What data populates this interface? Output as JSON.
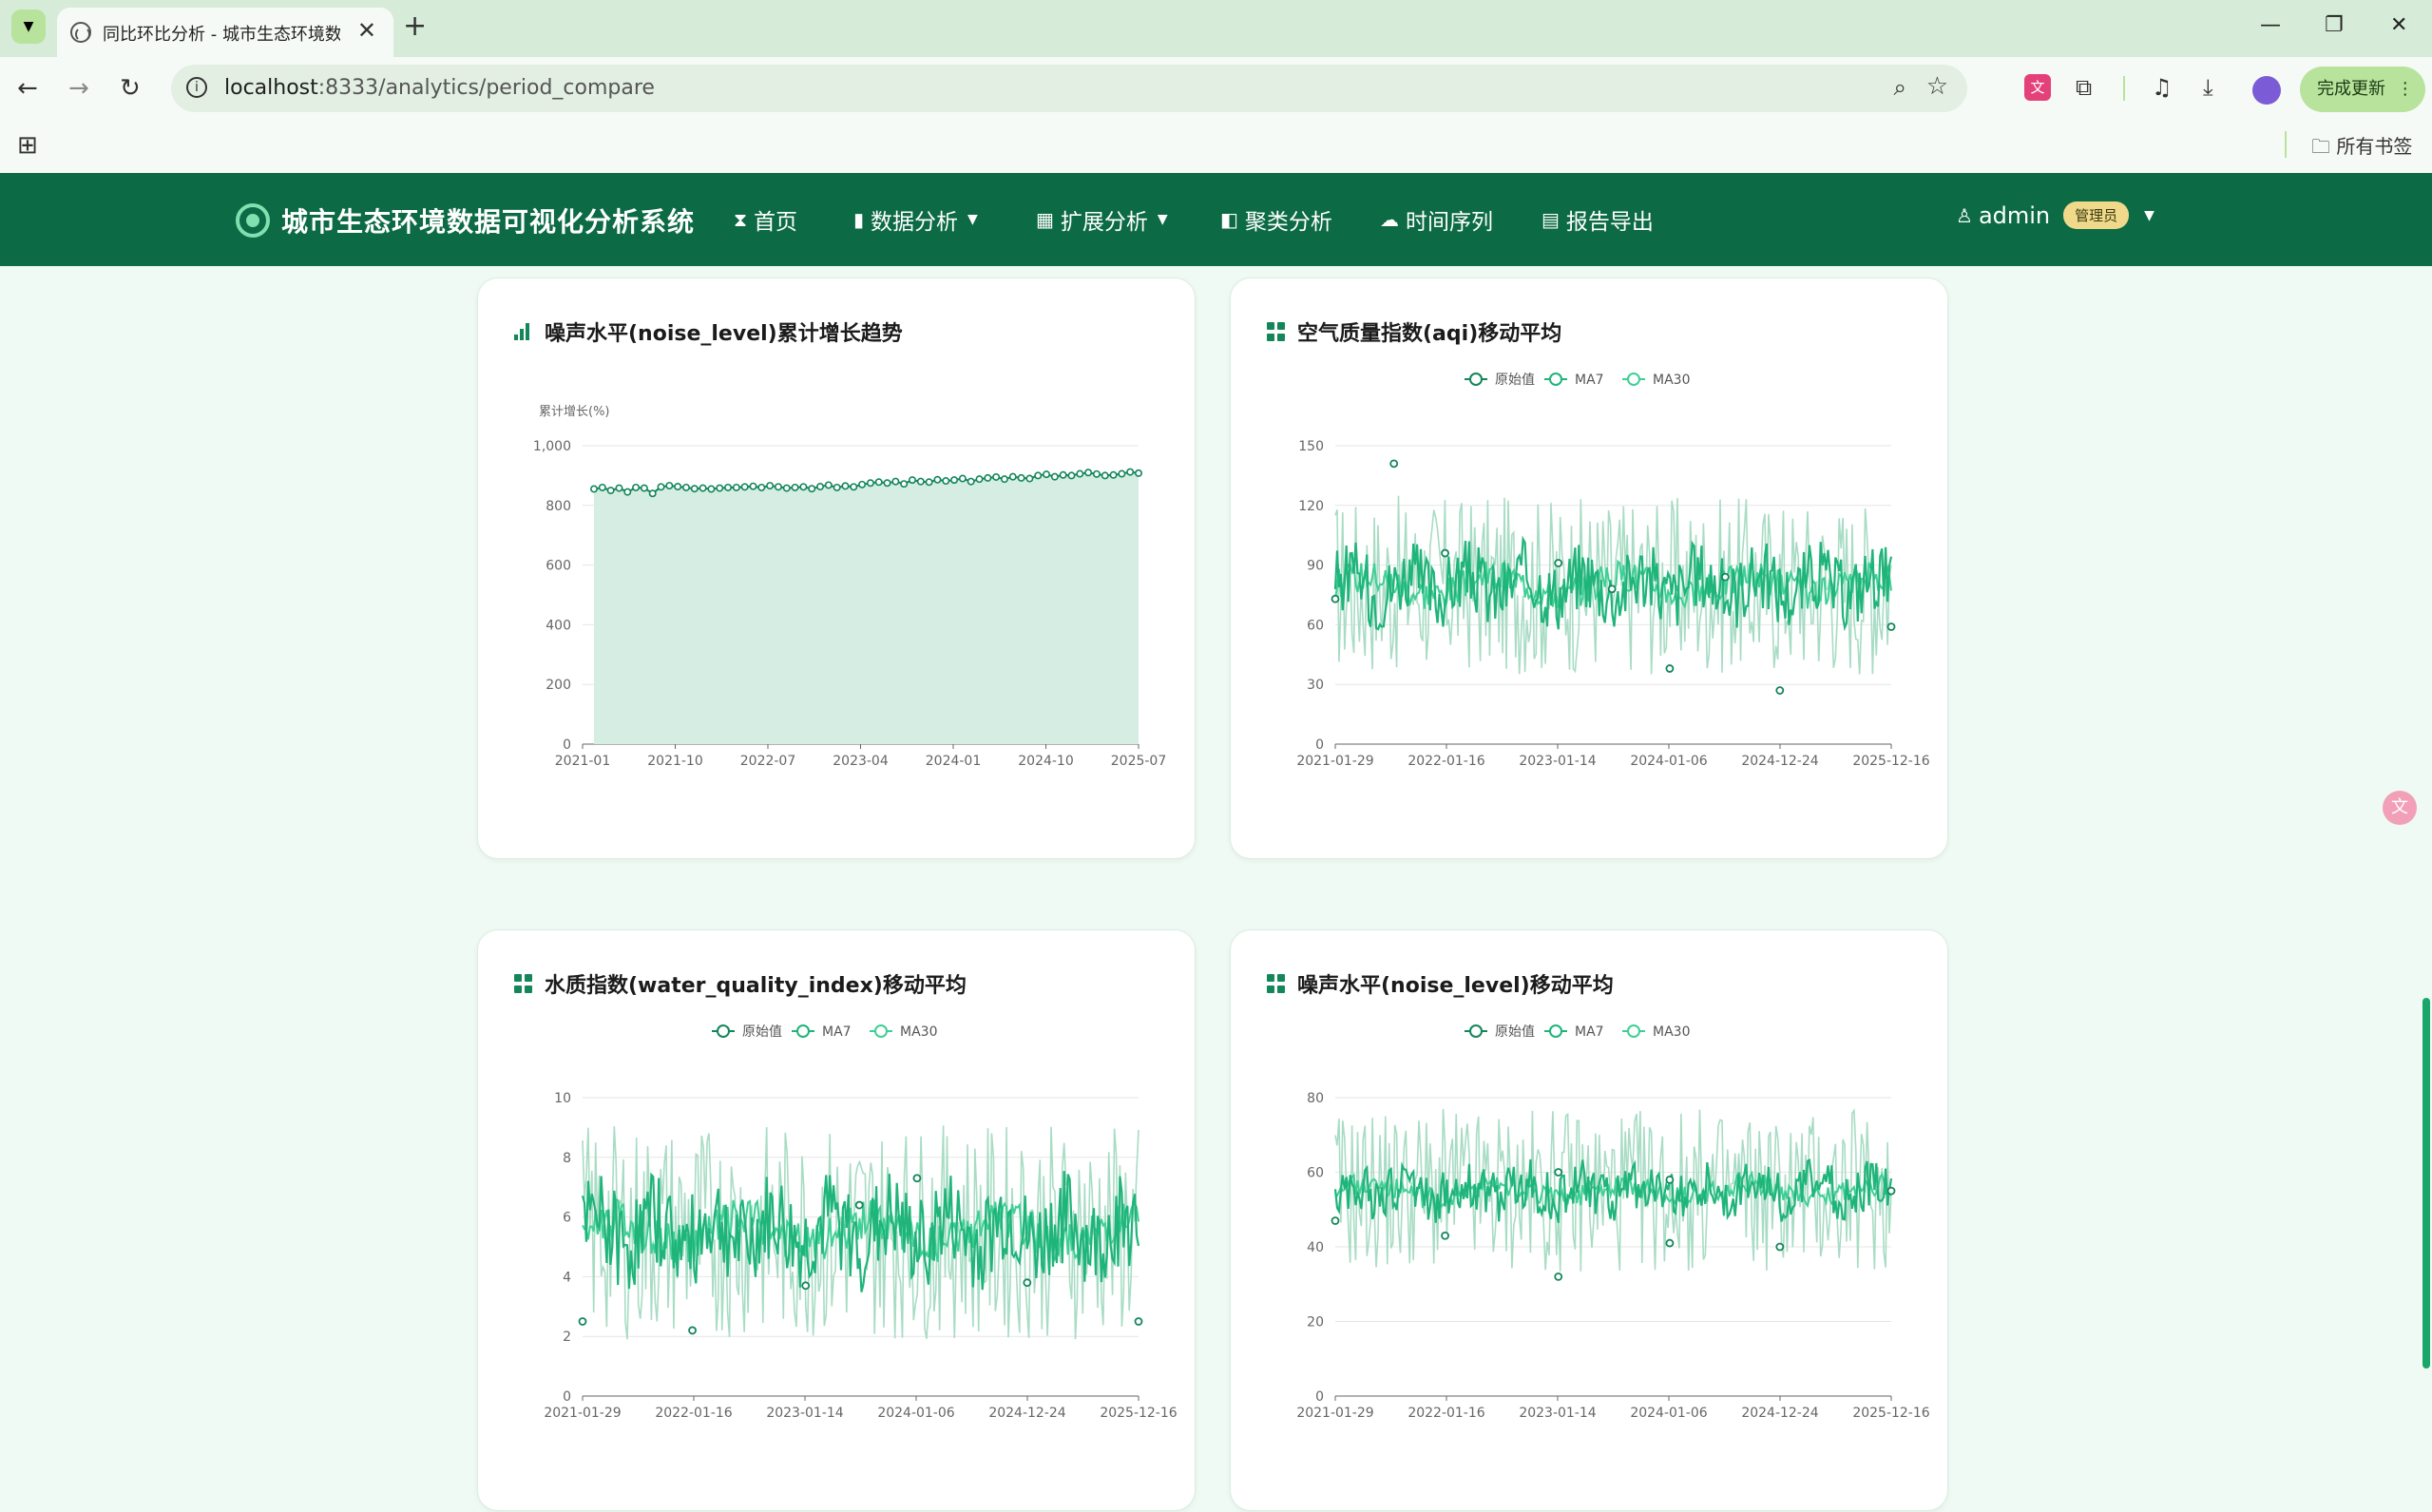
{
  "browser": {
    "tab_title": "同比环比分析 - 城市生态环境数",
    "url_host": "localhost",
    "url_rest": ":8333/analytics/period_compare",
    "update_button": "完成更新",
    "bookmarks_folder": "所有书签"
  },
  "nav": {
    "brand": "城市生态环境数据可视化分析系统",
    "items": [
      "首页",
      "数据分析",
      "扩展分析",
      "聚类分析",
      "时间序列",
      "报告导出"
    ],
    "user": "admin",
    "role": "管理员"
  },
  "cards": [
    {
      "title": "噪声水平(noise_level)累计增长趋势",
      "chart_data": {
        "type": "area",
        "title": "噪声水平(noise_level)累计增长趋势",
        "ylabel": "累计增长(%)",
        "ylim": [
          0,
          1000
        ],
        "yticks": [
          0,
          200,
          400,
          600,
          800,
          "1,000"
        ],
        "xtick_labels": [
          "2021-01",
          "2021-10",
          "2022-07",
          "2023-04",
          "2024-01",
          "2024-10",
          "2025-07"
        ],
        "x_start": "2021-01",
        "x_interval_months": 1,
        "values": [
          855,
          860,
          850,
          858,
          845,
          860,
          858,
          840,
          862,
          866,
          863,
          860,
          856,
          858,
          855,
          858,
          860,
          860,
          862,
          864,
          860,
          866,
          862,
          858,
          860,
          862,
          856,
          863,
          868,
          860,
          865,
          862,
          870,
          875,
          878,
          875,
          880,
          872,
          885,
          880,
          878,
          886,
          882,
          885,
          890,
          880,
          888,
          892,
          895,
          888,
          896,
          892,
          890,
          900,
          904,
          896,
          902,
          900,
          906,
          910,
          905,
          900,
          902,
          906,
          912,
          908
        ]
      }
    },
    {
      "title": "空气质量指数(aqi)移动平均",
      "chart_data": {
        "type": "line",
        "title": "空气质量指数(aqi)移动平均",
        "legend": [
          "原始值",
          "MA7",
          "MA30"
        ],
        "ylim": [
          0,
          150
        ],
        "yticks": [
          0,
          30,
          60,
          90,
          120,
          150
        ],
        "xtick_labels": [
          "2021-01-29",
          "2022-01-16",
          "2023-01-14",
          "2024-01-06",
          "2024-12-24",
          "2025-12-16"
        ],
        "raw_mean": 80,
        "raw_amplitude": 45,
        "ma7_mean": 80,
        "ma7_amplitude": 18,
        "ma30_mean": 80,
        "ma30_amplitude": 8,
        "markers": [
          {
            "x": "2021-01-29",
            "y": 73
          },
          {
            "x": "2021-08-05",
            "y": 141
          },
          {
            "x": "2022-01-16",
            "y": 96
          },
          {
            "x": "2023-01-14",
            "y": 91
          },
          {
            "x": "2023-07-05",
            "y": 78
          },
          {
            "x": "2024-01-06",
            "y": 38
          },
          {
            "x": "2024-07-02",
            "y": 84
          },
          {
            "x": "2024-12-24",
            "y": 27
          },
          {
            "x": "2025-12-16",
            "y": 59
          }
        ]
      }
    },
    {
      "title": "水质指数(water_quality_index)移动平均",
      "chart_data": {
        "type": "line",
        "title": "水质指数(water_quality_index)移动平均",
        "legend": [
          "原始值",
          "MA7",
          "MA30"
        ],
        "ylim": [
          0,
          10
        ],
        "yticks": [
          0,
          2,
          4,
          6,
          8,
          10
        ],
        "xtick_labels": [
          "2021-01-29",
          "2022-01-16",
          "2023-01-14",
          "2024-01-06",
          "2024-12-24",
          "2025-12-16"
        ],
        "raw_mean": 5.5,
        "raw_amplitude": 3.6,
        "ma7_mean": 5.5,
        "ma7_amplitude": 1.6,
        "ma30_mean": 5.5,
        "ma30_amplitude": 0.7,
        "markers": [
          {
            "x": "2021-01-29",
            "y": 2.5
          },
          {
            "x": "2022-01-16",
            "y": 2.2
          },
          {
            "x": "2023-01-14",
            "y": 3.7
          },
          {
            "x": "2023-07-05",
            "y": 6.4
          },
          {
            "x": "2024-01-06",
            "y": 7.3
          },
          {
            "x": "2024-12-24",
            "y": 3.8
          },
          {
            "x": "2025-12-16",
            "y": 2.5
          }
        ]
      }
    },
    {
      "title": "噪声水平(noise_level)移动平均",
      "chart_data": {
        "type": "line",
        "title": "噪声水平(noise_level)移动平均",
        "legend": [
          "原始值",
          "MA7",
          "MA30"
        ],
        "ylim": [
          0,
          80
        ],
        "yticks": [
          0,
          20,
          40,
          60,
          80
        ],
        "xtick_labels": [
          "2021-01-29",
          "2022-01-16",
          "2023-01-14",
          "2024-01-06",
          "2024-12-24",
          "2025-12-16"
        ],
        "raw_mean": 55,
        "raw_amplitude": 22,
        "ma7_mean": 55,
        "ma7_amplitude": 7,
        "ma30_mean": 55,
        "ma30_amplitude": 3,
        "markers": [
          {
            "x": "2021-01-29",
            "y": 47
          },
          {
            "x": "2022-01-16",
            "y": 43
          },
          {
            "x": "2023-01-14",
            "y": 32
          },
          {
            "x": "2023-01-14",
            "y": 60
          },
          {
            "x": "2024-01-06",
            "y": 41
          },
          {
            "x": "2024-01-06",
            "y": 58
          },
          {
            "x": "2024-12-24",
            "y": 40
          },
          {
            "x": "2025-12-16",
            "y": 55
          }
        ]
      }
    }
  ],
  "colors": {
    "navbar": "#0c6b45",
    "accent": "#13865a",
    "raw_line": "#a8dcc4",
    "ma7_line": "#1fb47a",
    "ma30_line": "#3fcf95",
    "area_fill": "#d5ede2"
  }
}
